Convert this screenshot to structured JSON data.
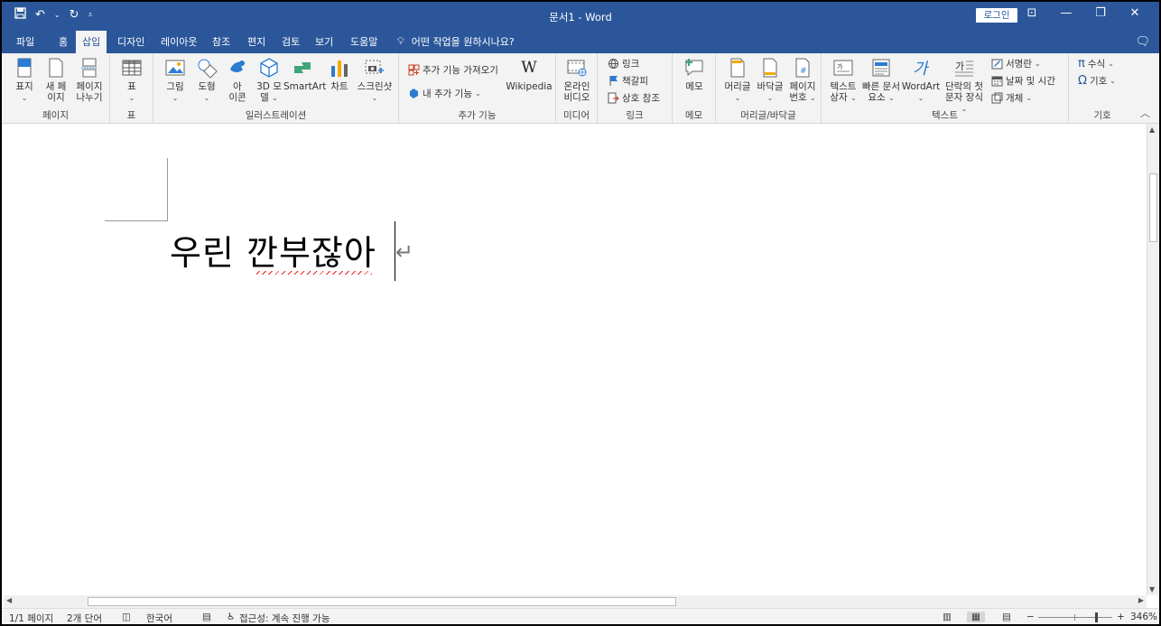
{
  "titlebar": {
    "doc_title": "문서1 - Word",
    "login": "로그인",
    "qat": [
      "save-icon",
      "undo-icon",
      "redo-icon",
      "customize-icon"
    ]
  },
  "tabs": [
    "파일",
    "홈",
    "삽입",
    "디자인",
    "레이아웃",
    "참조",
    "편지",
    "검토",
    "보기",
    "도움말"
  ],
  "active_tab": "삽입",
  "tell_me": "어떤 작업을 원하시나요?",
  "ribbon": {
    "pages": {
      "label": "페이지",
      "cover": "표지",
      "new1": "새 페",
      "new2": "이지",
      "break1": "페이지",
      "break2": "나누기"
    },
    "table": {
      "label": "표",
      "table": "표"
    },
    "illustrations": {
      "label": "일러스트레이션",
      "picture": "그림",
      "shapes": "도형",
      "icons1": "아",
      "icons2": "이콘",
      "model1": "3D 모",
      "model2": "델",
      "smartart": "SmartArt",
      "chart": "차트",
      "screenshot": "스크린샷"
    },
    "addins": {
      "label": "추가 기능",
      "get": "추가 기능 가져오기",
      "my": "내 추가 기능",
      "wiki": "Wikipedia"
    },
    "media": {
      "label": "미디어",
      "video1": "온라인",
      "video2": "비디오"
    },
    "links": {
      "label": "링크",
      "link": "링크",
      "bookmark": "책갈피",
      "cross": "상호 참조"
    },
    "comments": {
      "label": "메모",
      "memo": "메모"
    },
    "headerfooter": {
      "label": "머리글/바닥글",
      "header": "머리글",
      "footer": "바닥글",
      "pagenum1": "페이지",
      "pagenum2": "번호"
    },
    "text": {
      "label": "텍스트",
      "textbox1": "텍스트",
      "textbox2": "상자",
      "quick1": "빠른 문서",
      "quick2": "요소",
      "wordart": "WordArt",
      "dropcap1": "단락의 첫",
      "dropcap2": "문자 장식",
      "sigline": "서명란",
      "datetime": "날짜 및 시간",
      "object": "개체"
    },
    "symbols": {
      "label": "기호",
      "equation": "수식",
      "symbol": "기호"
    }
  },
  "document": {
    "text": "우린 깐부잖아"
  },
  "status": {
    "page": "1/1 페이지",
    "words": "2개 단어",
    "language": "한국어",
    "accessibility": "접근성: 계속 진행 가능",
    "zoom": "346%"
  }
}
